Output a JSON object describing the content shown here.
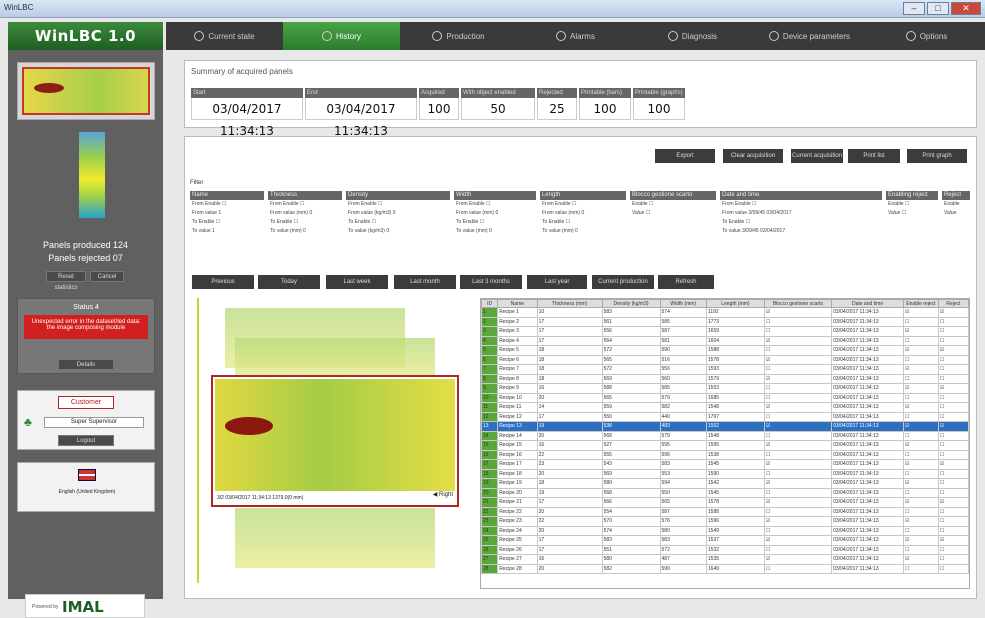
{
  "window": {
    "title": "WinLBC",
    "controls": [
      "–",
      "□",
      "✕"
    ]
  },
  "app": {
    "name": "WinLBC 1.0"
  },
  "sidebar": {
    "panels_produced": "Panels produced 124",
    "panels_rejected": "Panels rejected 07",
    "reset_label": "Reset statistics",
    "cancel_label": "Cancel",
    "status_title": "Status 4",
    "alert_text": "Unexpected error in the dataset/led data: the image composing module",
    "details_label": "Details",
    "customer_label": "Customer",
    "user_label": "Super Supervisor",
    "logout_label": "Logout",
    "language_label": "English (United Kingdom)",
    "powered_by": "Powered by",
    "brand": "IMAL"
  },
  "tabs": [
    {
      "label": "Current state",
      "icon": "circle-icon"
    },
    {
      "label": "History",
      "icon": "history-icon",
      "active": true
    },
    {
      "label": "Production",
      "icon": "production-icon"
    },
    {
      "label": "Alarms",
      "icon": "warning-icon"
    },
    {
      "label": "Diagnosis",
      "icon": "diagnosis-icon"
    },
    {
      "label": "Device parameters",
      "icon": "parameters-icon"
    },
    {
      "label": "Options",
      "icon": "gear-icon"
    }
  ],
  "summary": {
    "title": "Summary of acquired panels",
    "columns": [
      {
        "h": "Start",
        "v": "03/04/2017 11:34:13"
      },
      {
        "h": "End",
        "v": "03/04/2017 11:34:13"
      },
      {
        "h": "Acquired",
        "v": "100"
      },
      {
        "h": "With object enabled",
        "v": "50"
      },
      {
        "h": "Rejected",
        "v": "25"
      },
      {
        "h": "Printable (bars)",
        "v": "100"
      },
      {
        "h": "Printable (graphs)",
        "v": "100"
      }
    ]
  },
  "actions": [
    "Export",
    "Clear acquisition",
    "Current acquisition",
    "Print list",
    "Print graph"
  ],
  "filter": {
    "title": "Filter",
    "columns": [
      {
        "h": "Name",
        "rows": [
          "From Enable ☐",
          "From value 1",
          "To Enable ☐",
          "To value 1"
        ]
      },
      {
        "h": "Thickness",
        "rows": [
          "From Enable ☐",
          "From value (mm) 0",
          "To Enable ☐",
          "To value (mm) 0"
        ]
      },
      {
        "h": "Density",
        "rows": [
          "From Enable ☐",
          "From value (kg/m3) 0",
          "To Enable ☐",
          "To value (kg/m3) 0"
        ]
      },
      {
        "h": "Width",
        "rows": [
          "From Enable ☐",
          "From value (mm) 0",
          "To Enable ☐",
          "To value (mm) 0"
        ]
      },
      {
        "h": "Length",
        "rows": [
          "From Enable ☐",
          "From value (mm) 0",
          "To Enable ☐",
          "To value (mm) 0"
        ]
      },
      {
        "h": "Blocco gestione scarto",
        "rows": [
          "Enable ☐",
          "Value ☐"
        ]
      },
      {
        "h": "Date and time",
        "rows": [
          "From Enable ☐",
          "From value 3/09/45  03/04/2017",
          "To Enable ☐",
          "To value 3/09/45  03/04/2017"
        ]
      },
      {
        "h": "Enabling reject",
        "rows": [
          "Enable ☐",
          "Value ☐"
        ]
      },
      {
        "h": "Reject",
        "rows": [
          "Enable",
          "Value"
        ]
      }
    ]
  },
  "tools": [
    "Previous",
    "Today",
    "Last week",
    "Last month",
    "Last 3 months",
    "Last year",
    "Current production",
    "Refresh"
  ],
  "viewer": {
    "caption": "3/2  03/04/2017 11:34:13  1379.0(0 mm)",
    "direction_label": "Right"
  },
  "table": {
    "headers": [
      "ID",
      "Name",
      "Thickness (mm)",
      "Density (kg/m3)",
      "Width (mm)",
      "Length (mm)",
      "Blocco gestione scarto",
      "Date and time",
      "Enable reject",
      "Reject"
    ],
    "rows": [
      [
        "1",
        "Recipe 1",
        "10",
        "583",
        "574",
        "1192",
        "☑",
        "03/04/2017 11:34:13",
        "☑",
        "☑"
      ],
      [
        "2",
        "Recipe 2",
        "17",
        "561",
        "585",
        "1773",
        "☐",
        "03/04/2017 11:34:13",
        "☐",
        "☐"
      ],
      [
        "3",
        "Recipe 3",
        "17",
        "556",
        "587",
        "1659",
        "☐",
        "03/04/2017 11:34:13",
        "☑",
        "☐"
      ],
      [
        "4",
        "Recipe 4",
        "17",
        "564",
        "581",
        "1604",
        "☑",
        "03/04/2017 11:34:13",
        "☐",
        "☐"
      ],
      [
        "5",
        "Recipe 5",
        "18",
        "572",
        "590",
        "1588",
        "☐",
        "03/04/2017 11:34:13",
        "☑",
        "☑"
      ],
      [
        "6",
        "Recipe 6",
        "18",
        "565",
        "516",
        "1578",
        "☑",
        "03/04/2017 11:34:13",
        "☐",
        "☐"
      ],
      [
        "7",
        "Recipe 7",
        "18",
        "572",
        "556",
        "1593",
        "☐",
        "03/04/2017 11:34:13",
        "☑",
        "☐"
      ],
      [
        "8",
        "Recipe 8",
        "18",
        "569",
        "560",
        "1579",
        "☑",
        "03/04/2017 11:34:13",
        "☐",
        "☐"
      ],
      [
        "9",
        "Recipe 9",
        "16",
        "588",
        "585",
        "1553",
        "☐",
        "03/04/2017 11:34:13",
        "☑",
        "☑"
      ],
      [
        "10",
        "Recipe 10",
        "20",
        "565",
        "579",
        "1685",
        "☐",
        "03/04/2017 11:34:13",
        "☐",
        "☐"
      ],
      [
        "11",
        "Recipe 11",
        "14",
        "559",
        "582",
        "1548",
        "☑",
        "03/04/2017 11:34:13",
        "☑",
        "☐"
      ],
      [
        "12",
        "Recipe 12",
        "17",
        "550",
        "440",
        "1797",
        "☐",
        "03/04/2017 11:34:13",
        "☐",
        "☐"
      ],
      [
        "13",
        "Recipe 13",
        "19",
        "538",
        "483",
        "1502",
        "☑",
        "03/04/2017 11:34:13",
        "☑",
        "☑"
      ],
      [
        "14",
        "Recipe 14",
        "20",
        "568",
        "579",
        "1548",
        "☐",
        "03/04/2017 11:34:13",
        "☐",
        "☐"
      ],
      [
        "15",
        "Recipe 15",
        "16",
        "527",
        "595",
        "1595",
        "☑",
        "03/04/2017 11:34:13",
        "☑",
        "☐"
      ],
      [
        "16",
        "Recipe 16",
        "22",
        "555",
        "596",
        "1538",
        "☐",
        "03/04/2017 11:34:13",
        "☐",
        "☐"
      ],
      [
        "17",
        "Recipe 17",
        "23",
        "543",
        "583",
        "1545",
        "☑",
        "03/04/2017 11:34:13",
        "☑",
        "☑"
      ],
      [
        "18",
        "Recipe 18",
        "20",
        "569",
        "553",
        "1590",
        "☐",
        "03/04/2017 11:34:13",
        "☐",
        "☐"
      ],
      [
        "19",
        "Recipe 19",
        "18",
        "580",
        "594",
        "1542",
        "☑",
        "03/04/2017 11:34:13",
        "☑",
        "☐"
      ],
      [
        "20",
        "Recipe 20",
        "19",
        "568",
        "550",
        "1545",
        "☐",
        "03/04/2017 11:34:13",
        "☐",
        "☐"
      ],
      [
        "21",
        "Recipe 21",
        "17",
        "566",
        "565",
        "1578",
        "☑",
        "03/04/2017 11:34:13",
        "☑",
        "☑"
      ],
      [
        "22",
        "Recipe 22",
        "20",
        "554",
        "587",
        "1588",
        "☐",
        "03/04/2017 11:34:13",
        "☐",
        "☐"
      ],
      [
        "23",
        "Recipe 23",
        "22",
        "570",
        "576",
        "1596",
        "☑",
        "03/04/2017 11:34:13",
        "☑",
        "☐"
      ],
      [
        "24",
        "Recipe 24",
        "20",
        "574",
        "580",
        "1549",
        "☐",
        "03/04/2017 11:34:13",
        "☐",
        "☐"
      ],
      [
        "25",
        "Recipe 25",
        "17",
        "583",
        "583",
        "1537",
        "☑",
        "03/04/2017 11:34:13",
        "☑",
        "☑"
      ],
      [
        "26",
        "Recipe 26",
        "17",
        "551",
        "572",
        "1532",
        "☐",
        "03/04/2017 11:34:13",
        "☐",
        "☐"
      ],
      [
        "27",
        "Recipe 27",
        "16",
        "580",
        "487",
        "1535",
        "☑",
        "03/04/2017 11:34:13",
        "☑",
        "☐"
      ],
      [
        "28",
        "Recipe 28",
        "20",
        "582",
        "590",
        "1649",
        "☐",
        "03/04/2017 11:34:13",
        "☐",
        "☐"
      ]
    ],
    "selected_row": "13"
  }
}
